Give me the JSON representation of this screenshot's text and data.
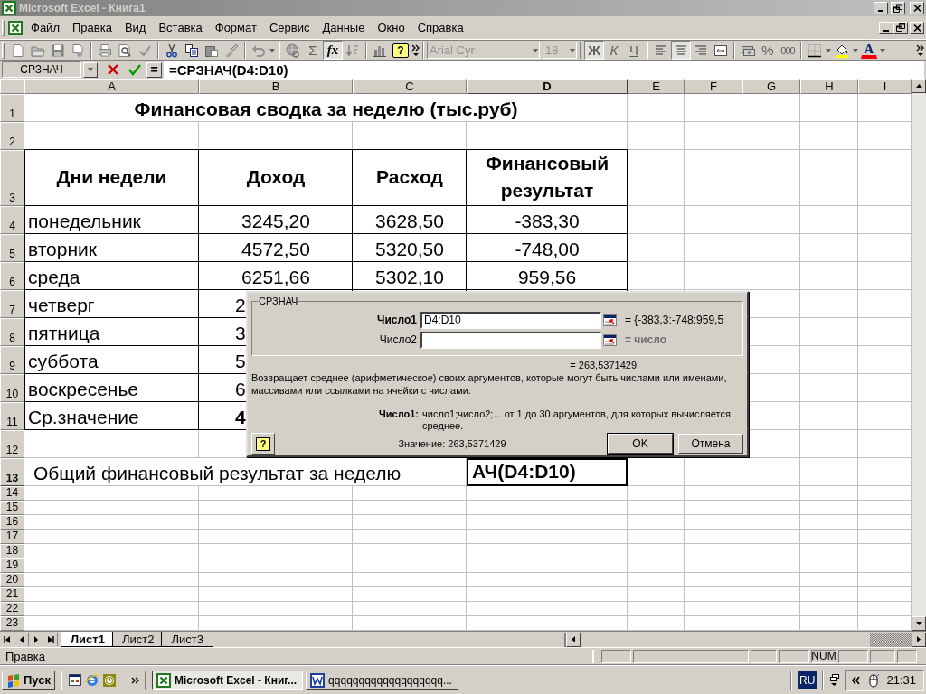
{
  "window": {
    "title": "Microsoft Excel - Книга1"
  },
  "menu": [
    "Файл",
    "Правка",
    "Вид",
    "Вставка",
    "Формат",
    "Сервис",
    "Данные",
    "Окно",
    "Справка"
  ],
  "toolbar": {
    "autosum": "Σ",
    "insert_function": {
      "label": "fx",
      "on": true
    },
    "help": "?",
    "font": {
      "value": "Arial Cyr",
      "disabled": true
    },
    "font_size": {
      "value": "18",
      "disabled": true
    },
    "bold": {
      "label": "Ж",
      "on": true
    },
    "italic": {
      "label": "К",
      "on": false
    },
    "underline": {
      "label": "Ч",
      "on": false
    },
    "alignment": [
      {
        "selected": false
      },
      {
        "selected": true
      },
      {
        "selected": false
      }
    ],
    "percent": "%",
    "thousands": "000",
    "font_color": "A"
  },
  "formula_bar": {
    "name_box": "СРЗНАЧ",
    "equals": "=",
    "formula": "=СРЗНАЧ(D4:D10)"
  },
  "sheet": {
    "columns": [
      {
        "label": "A",
        "selected": false
      },
      {
        "label": "B",
        "selected": false
      },
      {
        "label": "C",
        "selected": false
      },
      {
        "label": "D",
        "selected": true
      },
      {
        "label": "E",
        "selected": false
      },
      {
        "label": "F",
        "selected": false
      },
      {
        "label": "G",
        "selected": false
      },
      {
        "label": "H",
        "selected": false
      },
      {
        "label": "I",
        "selected": false
      }
    ],
    "rows": [
      {
        "number": "1",
        "kind": "title",
        "selected": false,
        "text": "Финансовая сводка за неделю (тыс.руб)"
      },
      {
        "number": "2",
        "kind": "blank",
        "selected": false
      },
      {
        "number": "3",
        "kind": "header",
        "selected": false,
        "cells": [
          "Дни недели",
          "Доход",
          "Расход",
          "Финансовый результат"
        ]
      },
      {
        "number": "4",
        "kind": "data",
        "selected": false,
        "cells": [
          "понедельник",
          "3245,20",
          "3628,50",
          "-383,30"
        ]
      },
      {
        "number": "5",
        "kind": "data",
        "selected": false,
        "cells": [
          "вторник",
          "4572,50",
          "5320,50",
          "-748,00"
        ]
      },
      {
        "number": "6",
        "kind": "data",
        "selected": false,
        "cells": [
          "среда",
          "6251,66",
          "5302,10",
          "959,56"
        ]
      },
      {
        "number": "7",
        "kind": "covered",
        "selected": false,
        "cells": [
          "четверг",
          "2"
        ]
      },
      {
        "number": "8",
        "kind": "covered",
        "selected": false,
        "cells": [
          "пятница",
          "3"
        ]
      },
      {
        "number": "9",
        "kind": "covered",
        "selected": false,
        "cells": [
          "суббота",
          "5"
        ]
      },
      {
        "number": "10",
        "kind": "covered",
        "selected": false,
        "cells": [
          "воскресенье",
          "6"
        ]
      },
      {
        "number": "11",
        "kind": "average",
        "selected": false,
        "cells": [
          "Ср.значение",
          "4"
        ]
      },
      {
        "number": "12",
        "kind": "blank",
        "selected": false
      },
      {
        "number": "13",
        "kind": "total",
        "selected": true,
        "label": "Общий финансовый результат за неделю",
        "value": "АЧ(D4:D10)"
      },
      {
        "number": "14",
        "kind": "empty",
        "selected": false
      },
      {
        "number": "15",
        "kind": "empty",
        "selected": false
      },
      {
        "number": "16",
        "kind": "empty",
        "selected": false
      },
      {
        "number": "17",
        "kind": "empty",
        "selected": false
      },
      {
        "number": "18",
        "kind": "empty",
        "selected": false
      },
      {
        "number": "19",
        "kind": "empty",
        "selected": false
      },
      {
        "number": "20",
        "kind": "empty",
        "selected": false
      },
      {
        "number": "21",
        "kind": "empty",
        "selected": false
      },
      {
        "number": "22",
        "kind": "empty",
        "selected": false
      },
      {
        "number": "23",
        "kind": "empty",
        "selected": false
      }
    ]
  },
  "dialog": {
    "function": "СРЗНАЧ",
    "arguments": [
      {
        "label": "Число1",
        "value": "D4:D10",
        "result": "= {-383,3:-748:959,5",
        "active": true
      },
      {
        "label": "Число2",
        "result": "= число",
        "active": false
      }
    ],
    "result": "= 263,5371429",
    "description": "Возвращает среднее (арифметическое) своих аргументов, которые могут быть числами или именами, массивами или ссылками на ячейки с числами.",
    "argument_help": {
      "label": "Число1:",
      "text": "число1;число2;... от 1 до 30 аргументов, для которых вычисляется среднее."
    },
    "help": "?",
    "value": "Значение: 263,5371429",
    "buttons": [
      {
        "label": "OK",
        "default": true
      },
      {
        "label": "Отмена",
        "default": false
      }
    ]
  },
  "sheet_tabs": [
    {
      "label": "Лист1",
      "selected": true
    },
    {
      "label": "Лист2",
      "selected": false
    },
    {
      "label": "Лист3",
      "selected": false
    }
  ],
  "status_bar": {
    "mode": "Правка",
    "indicators": [
      "NUM"
    ]
  },
  "taskbar": {
    "start": "Пуск",
    "tasks": [
      {
        "label": "Microsoft Excel - Книг...",
        "kind": "excel",
        "selected": true
      },
      {
        "label": "qqqqqqqqqqqqqqqqqqq...",
        "kind": "word",
        "selected": false
      }
    ],
    "language": "RU",
    "clock": "21:31"
  }
}
